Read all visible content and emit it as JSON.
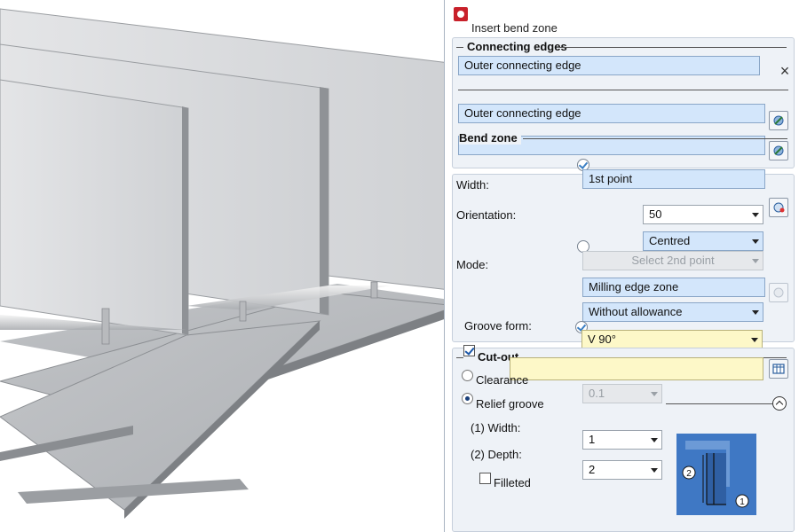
{
  "dialog": {
    "title": "Insert bend zone",
    "close_glyph": "×",
    "icon": "app-logo-icon"
  },
  "connecting_edges": {
    "group_title": "Connecting edges",
    "edge1": "Outer connecting edge",
    "edge2": "Outer connecting edge"
  },
  "bend_zone": {
    "group_title": "Bend zone",
    "first_point": "1st point",
    "width_label": "Width:",
    "width_value": "50",
    "orientation_label": "Orientation:",
    "orientation_value": "Centred",
    "second_point": "Select 2nd point",
    "mode_label": "Mode:",
    "mode_value": "Milling edge zone",
    "allowance_value": "Without allowance",
    "groove_form_label": "Groove form:",
    "groove_form_value": "V 90°"
  },
  "cut_out": {
    "group_title": "Cut-out",
    "checked": true,
    "clearance_label": "Clearance",
    "clearance_value": "0.1",
    "relief_groove_label": "Relief groove",
    "selected_option": "Relief groove",
    "width_label": "(1) Width:",
    "width_value": "1",
    "depth_label": "(2) Depth:",
    "depth_value": "2",
    "filleted_label": "Filleted",
    "filleted_checked": false,
    "diagram_label_1": "1",
    "diagram_label_2": "2"
  },
  "colors": {
    "field_blue": "#d3e6fb",
    "field_yellow": "#fdf8c8",
    "group_bg": "#eef2f7",
    "diagram_blue": "#3f78c4"
  }
}
